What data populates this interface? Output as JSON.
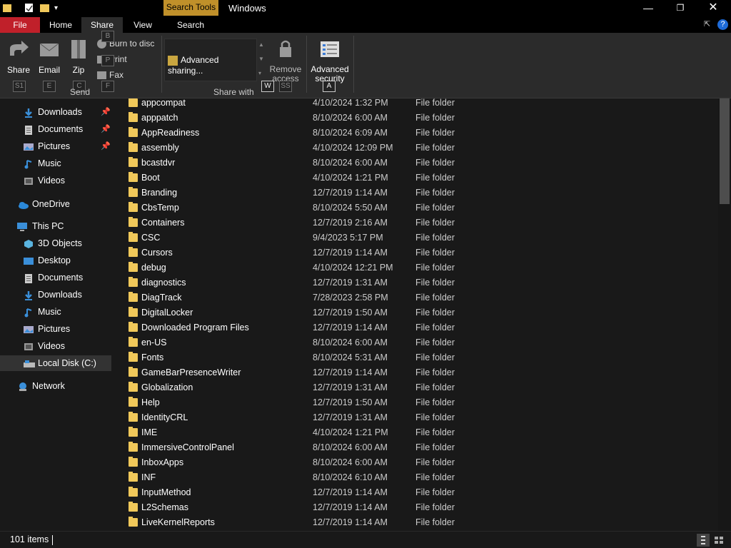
{
  "window": {
    "title": "Windows",
    "context_tab": "Search Tools"
  },
  "ribbon_tabs": [
    "File",
    "Home",
    "Share",
    "View",
    "Search"
  ],
  "ribbon": {
    "send": {
      "share": "Share",
      "email": "Email",
      "zip": "Zip",
      "burn": "Burn to disc",
      "print": "Print",
      "fax": "Fax",
      "group": "Send"
    },
    "share_with": {
      "advanced_sharing": "Advanced sharing...",
      "remove_access_line1": "Remove",
      "remove_access_line2": "access",
      "group": "Share with"
    },
    "security": {
      "line1": "Advanced",
      "line2": "security"
    },
    "keytips": {
      "share": "S1",
      "email": "E",
      "zip": "C",
      "fax": "F",
      "burn": "B",
      "print": "P",
      "w": "W",
      "ss": "SS",
      "a": "A"
    }
  },
  "nav": {
    "quick": [
      {
        "label": "Downloads",
        "icon": "download-icon",
        "pinned": true
      },
      {
        "label": "Documents",
        "icon": "documents-icon",
        "pinned": true
      },
      {
        "label": "Pictures",
        "icon": "pictures-icon",
        "pinned": true
      },
      {
        "label": "Music",
        "icon": "music-icon",
        "pinned": false
      },
      {
        "label": "Videos",
        "icon": "videos-icon",
        "pinned": false
      }
    ],
    "onedrive": "OneDrive",
    "thispc": "This PC",
    "pc": [
      {
        "label": "3D Objects",
        "icon": "3d-objects-icon"
      },
      {
        "label": "Desktop",
        "icon": "desktop-icon"
      },
      {
        "label": "Documents",
        "icon": "documents-icon"
      },
      {
        "label": "Downloads",
        "icon": "download-icon"
      },
      {
        "label": "Music",
        "icon": "music-icon"
      },
      {
        "label": "Pictures",
        "icon": "pictures-icon"
      },
      {
        "label": "Videos",
        "icon": "videos-icon"
      },
      {
        "label": "Local Disk (C:)",
        "icon": "drive-icon"
      }
    ],
    "network": "Network"
  },
  "files": [
    {
      "name": "appcompat",
      "date": "4/10/2024 1:32 PM",
      "type": "File folder"
    },
    {
      "name": "apppatch",
      "date": "8/10/2024 6:00 AM",
      "type": "File folder"
    },
    {
      "name": "AppReadiness",
      "date": "8/10/2024 6:09 AM",
      "type": "File folder"
    },
    {
      "name": "assembly",
      "date": "4/10/2024 12:09 PM",
      "type": "File folder"
    },
    {
      "name": "bcastdvr",
      "date": "8/10/2024 6:00 AM",
      "type": "File folder"
    },
    {
      "name": "Boot",
      "date": "4/10/2024 1:21 PM",
      "type": "File folder"
    },
    {
      "name": "Branding",
      "date": "12/7/2019 1:14 AM",
      "type": "File folder"
    },
    {
      "name": "CbsTemp",
      "date": "8/10/2024 5:50 AM",
      "type": "File folder"
    },
    {
      "name": "Containers",
      "date": "12/7/2019 2:16 AM",
      "type": "File folder"
    },
    {
      "name": "CSC",
      "date": "9/4/2023 5:17 PM",
      "type": "File folder"
    },
    {
      "name": "Cursors",
      "date": "12/7/2019 1:14 AM",
      "type": "File folder"
    },
    {
      "name": "debug",
      "date": "4/10/2024 12:21 PM",
      "type": "File folder"
    },
    {
      "name": "diagnostics",
      "date": "12/7/2019 1:31 AM",
      "type": "File folder"
    },
    {
      "name": "DiagTrack",
      "date": "7/28/2023 2:58 PM",
      "type": "File folder"
    },
    {
      "name": "DigitalLocker",
      "date": "12/7/2019 1:50 AM",
      "type": "File folder"
    },
    {
      "name": "Downloaded Program Files",
      "date": "12/7/2019 1:14 AM",
      "type": "File folder"
    },
    {
      "name": "en-US",
      "date": "8/10/2024 6:00 AM",
      "type": "File folder"
    },
    {
      "name": "Fonts",
      "date": "8/10/2024 5:31 AM",
      "type": "File folder"
    },
    {
      "name": "GameBarPresenceWriter",
      "date": "12/7/2019 1:14 AM",
      "type": "File folder"
    },
    {
      "name": "Globalization",
      "date": "12/7/2019 1:31 AM",
      "type": "File folder"
    },
    {
      "name": "Help",
      "date": "12/7/2019 1:50 AM",
      "type": "File folder"
    },
    {
      "name": "IdentityCRL",
      "date": "12/7/2019 1:31 AM",
      "type": "File folder"
    },
    {
      "name": "IME",
      "date": "4/10/2024 1:21 PM",
      "type": "File folder"
    },
    {
      "name": "ImmersiveControlPanel",
      "date": "8/10/2024 6:00 AM",
      "type": "File folder"
    },
    {
      "name": "InboxApps",
      "date": "8/10/2024 6:00 AM",
      "type": "File folder"
    },
    {
      "name": "INF",
      "date": "8/10/2024 6:10 AM",
      "type": "File folder"
    },
    {
      "name": "InputMethod",
      "date": "12/7/2019 1:14 AM",
      "type": "File folder"
    },
    {
      "name": "L2Schemas",
      "date": "12/7/2019 1:14 AM",
      "type": "File folder"
    },
    {
      "name": "LiveKernelReports",
      "date": "12/7/2019 1:14 AM",
      "type": "File folder"
    }
  ],
  "status": {
    "item_count": "101 items"
  }
}
